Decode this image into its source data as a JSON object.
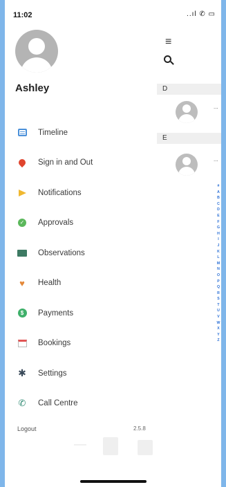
{
  "status_bar": {
    "time": "11:02",
    "icons": "..ıl ✆ ▭"
  },
  "drawer": {
    "user_name": "Ashley",
    "menu": [
      {
        "label": "Timeline",
        "icon": "timeline-icon"
      },
      {
        "label": "Sign in and Out",
        "icon": "location-pin-icon"
      },
      {
        "label": "Notifications",
        "icon": "megaphone-icon"
      },
      {
        "label": "Approvals",
        "icon": "check-circle-icon"
      },
      {
        "label": "Observations",
        "icon": "observations-icon"
      },
      {
        "label": "Health",
        "icon": "heart-icon"
      },
      {
        "label": "Payments",
        "icon": "payment-icon"
      },
      {
        "label": "Bookings",
        "icon": "calendar-icon"
      },
      {
        "label": "Settings",
        "icon": "gear-icon"
      },
      {
        "label": "Call Centre",
        "icon": "phone-icon"
      }
    ],
    "logout_label": "Logout",
    "version": "2.5.8"
  },
  "contacts": {
    "sections": [
      "D",
      "E"
    ],
    "contact_placeholder": "...",
    "index": [
      "#",
      "A",
      "B",
      "C",
      "D",
      "E",
      "F",
      "G",
      "H",
      "I",
      "J",
      "K",
      "L",
      "M",
      "N",
      "O",
      "P",
      "Q",
      "R",
      "S",
      "T",
      "U",
      "V",
      "W",
      "X",
      "Y",
      "Z"
    ]
  },
  "colors": {
    "background": "#7fb6ea",
    "index_accent": "#2a6fd6"
  }
}
